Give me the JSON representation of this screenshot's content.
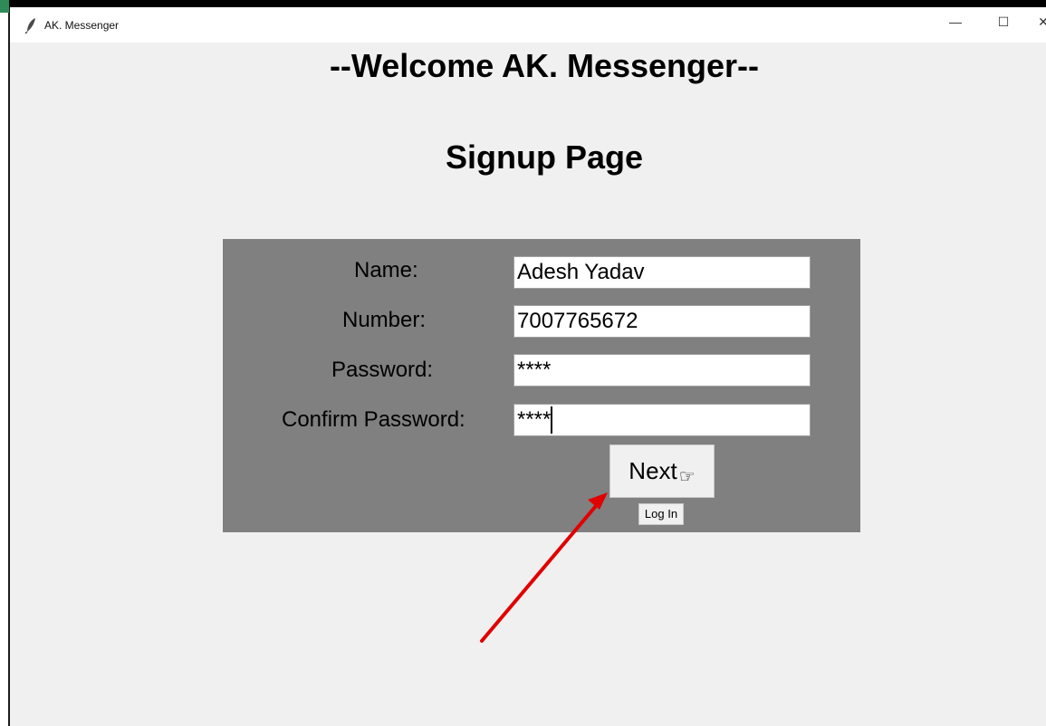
{
  "window": {
    "title": "AK. Messenger",
    "minimize_glyph": "—",
    "maximize_glyph": "☐",
    "close_glyph": "✕"
  },
  "page": {
    "heading": "--Welcome AK. Messenger--",
    "subheading": "Signup Page"
  },
  "form": {
    "name_label": "Name:",
    "name_value": "Adesh Yadav",
    "number_label": "Number:",
    "number_value": "7007765672",
    "password_label": "Password:",
    "password_value": "****",
    "confirm_label": "Confirm Password:",
    "confirm_value": "****",
    "next_label": "Next",
    "next_icon": "pointing-hand-icon",
    "login_label": "Log In"
  },
  "annotation": {
    "arrow_color": "#e00000"
  },
  "colors": {
    "panel_bg": "#808080",
    "window_bg": "#f0f0f0"
  }
}
